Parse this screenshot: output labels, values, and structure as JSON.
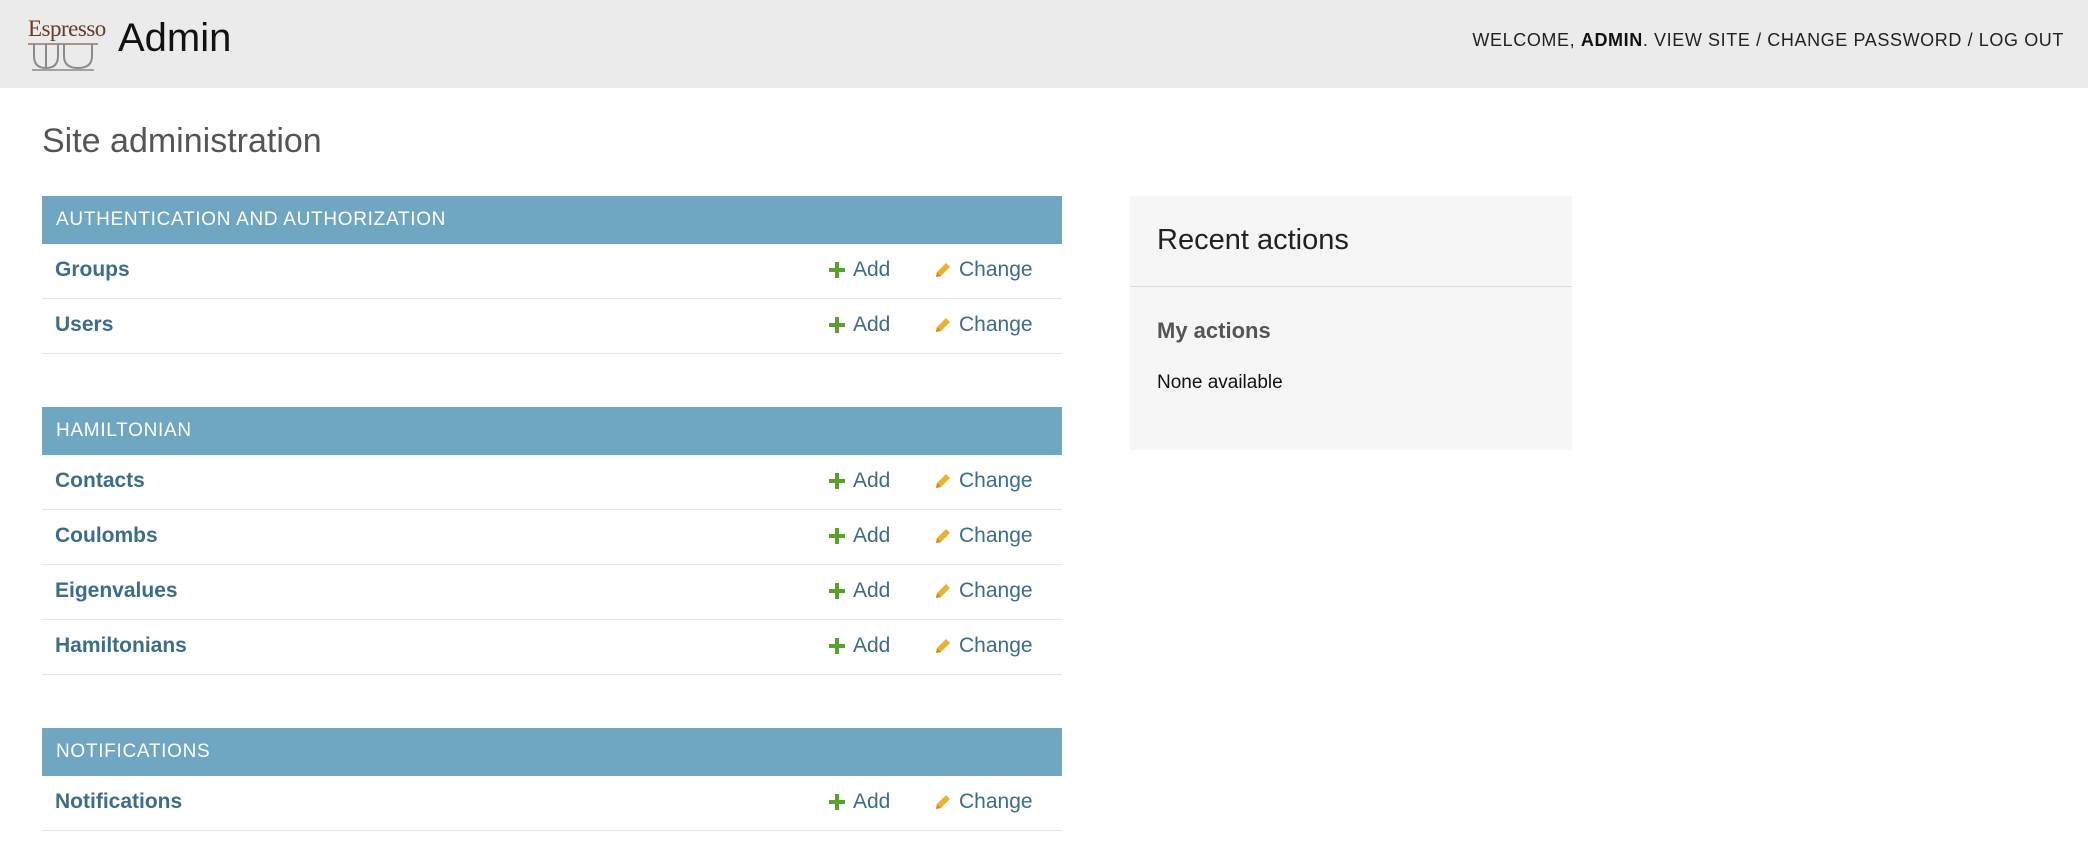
{
  "header": {
    "logo_text": "Espresso",
    "brand_title": "Admin",
    "welcome_prefix": "WELCOME, ",
    "username": "ADMIN",
    "welcome_suffix": ". ",
    "view_site": "VIEW SITE",
    "separator": " / ",
    "change_password": "CHANGE PASSWORD",
    "log_out": "LOG OUT"
  },
  "page": {
    "title": "Site administration"
  },
  "actions": {
    "add_label": "Add",
    "change_label": "Change"
  },
  "colors": {
    "header_bg": "#ebebeb",
    "module_caption_bg": "#6fa6c1",
    "link": "#3c6d8b",
    "add_icon": "#5aa02c",
    "change_icon": "#e8b330",
    "logo_text": "#6b3a22"
  },
  "modules": [
    {
      "caption": "AUTHENTICATION AND AUTHORIZATION",
      "models": [
        {
          "name": "Groups"
        },
        {
          "name": "Users"
        }
      ]
    },
    {
      "caption": "HAMILTONIAN",
      "models": [
        {
          "name": "Contacts"
        },
        {
          "name": "Coulombs"
        },
        {
          "name": "Eigenvalues"
        },
        {
          "name": "Hamiltonians"
        }
      ]
    },
    {
      "caption": "NOTIFICATIONS",
      "models": [
        {
          "name": "Notifications"
        }
      ]
    }
  ],
  "recent_actions": {
    "title": "Recent actions",
    "my_actions_title": "My actions",
    "empty_text": "None available"
  }
}
